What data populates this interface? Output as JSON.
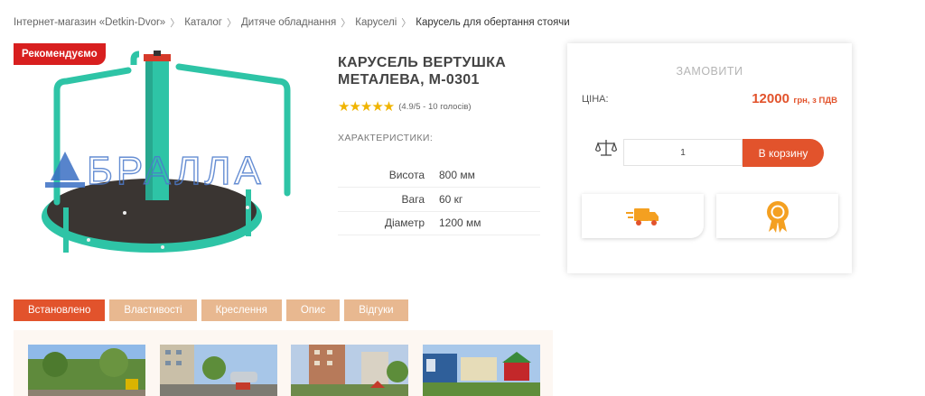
{
  "breadcrumb": {
    "items": [
      "Інтернет-магазин «Detkin-Dvor»",
      "Каталог",
      "Дитяче обладнання",
      "Каруселі"
    ],
    "current": "Карусель для обертання стоячи",
    "separator": "〉"
  },
  "badge": {
    "label": "Рекомендуємо"
  },
  "product": {
    "watermark": "БРАЛЛА",
    "title": "КАРУСЕЛЬ ВЕРТУШКА МЕТАЛЕВА, М-0301",
    "stars": "★★★★★",
    "rating_text": "(4.9/5 - 10 голосів)",
    "characteristics_heading": "ХАРАКТЕРИСТИКИ:",
    "specs": [
      {
        "key": "Висота",
        "value": "800 мм"
      },
      {
        "key": "Вага",
        "value": "60 кг"
      },
      {
        "key": "Діаметр",
        "value": "1200 мм"
      }
    ]
  },
  "order": {
    "title": "ЗАМОВИТИ",
    "price_label": "ЦІНА:",
    "price_value": "12000",
    "price_unit": "грн, з ПДВ",
    "quantity": "1",
    "cart_button": "В корзину",
    "icons": [
      "scales-icon",
      "delivery-truck-icon",
      "award-ribbon-icon"
    ]
  },
  "tabs": [
    {
      "label": "Встановлено",
      "active": true
    },
    {
      "label": "Властивості",
      "active": false
    },
    {
      "label": "Креслення",
      "active": false
    },
    {
      "label": "Опис",
      "active": false
    },
    {
      "label": "Відгуки",
      "active": false
    }
  ],
  "colors": {
    "accent": "#e2532c",
    "tab_inactive": "#e8b890",
    "badge": "#d81f1f",
    "stars": "#f0b400",
    "carousel_frame": "#2ec4a6"
  }
}
